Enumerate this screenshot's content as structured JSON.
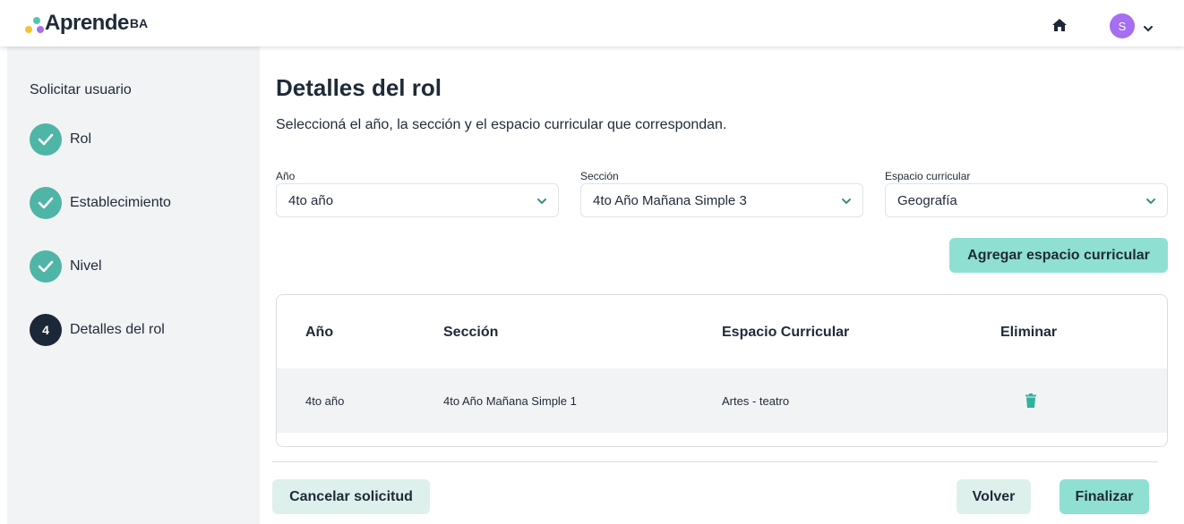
{
  "header": {
    "logo_text": "Aprende",
    "logo_suffix": "BA",
    "home_icon": "home-icon",
    "avatar_initial": "S",
    "avatar_color": "#a66ef0"
  },
  "sidebar": {
    "title": "Solicitar usuario",
    "steps": [
      {
        "label": "Rol",
        "status": "done"
      },
      {
        "label": "Establecimiento",
        "status": "done"
      },
      {
        "label": "Nivel",
        "status": "done"
      },
      {
        "label": "Detalles del rol",
        "status": "current",
        "number": "4"
      }
    ]
  },
  "main": {
    "title": "Detalles del rol",
    "description": "Seleccioná el año, la sección y el espacio curricular que correspondan.",
    "fields": {
      "anio": {
        "label": "Año",
        "value": "4to año"
      },
      "seccion": {
        "label": "Sección",
        "value": "4to Año Mañana Simple 3"
      },
      "espacio": {
        "label": "Espacio curricular",
        "value": "Geografía"
      }
    },
    "add_button": "Agregar espacio curricular",
    "table": {
      "headers": [
        "Año",
        "Sección",
        "Espacio Curricular",
        "Eliminar"
      ],
      "rows": [
        {
          "anio": "4to año",
          "seccion": "4to Año Mañana Simple 1",
          "espacio": "Artes - teatro"
        }
      ]
    }
  },
  "footer": {
    "cancel_button": "Cancelar solicitud",
    "back_button": "Volver",
    "finish_button": "Finalizar"
  },
  "colors": {
    "accent": "#4fb5a6",
    "button_teal": "#8fe0d2",
    "button_light": "#def0ec",
    "step_current": "#1c2838"
  }
}
